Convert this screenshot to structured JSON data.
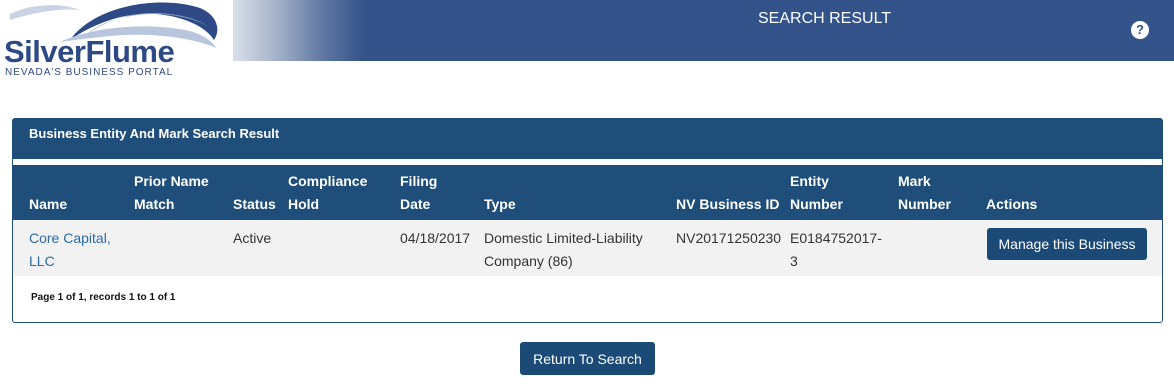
{
  "header": {
    "logo_main": "SilverFlume",
    "logo_sub": "NEVADA'S BUSINESS PORTAL",
    "title": "SEARCH RESULT",
    "help_glyph": "?"
  },
  "results": {
    "panel_title": "Business Entity And Mark Search Result",
    "columns": {
      "name": "Name",
      "prior_name_1": "Prior Name",
      "prior_name_2": "Match",
      "status": "Status",
      "compliance_1": "Compliance",
      "compliance_2": "Hold",
      "filing_1": "Filing",
      "filing_2": "Date",
      "type": "Type",
      "nv_id": "NV Business ID",
      "entity_1": "Entity",
      "entity_2": "Number",
      "mark_1": "Mark",
      "mark_2": "Number",
      "actions": "Actions"
    },
    "rows": [
      {
        "name_1": "Core Capital,",
        "name_2": "LLC",
        "prior_name_match": "",
        "status": "Active",
        "compliance_hold": "",
        "filing_date": "04/18/2017",
        "type_1": "Domestic Limited-Liability",
        "type_2": "Company (86)",
        "nv_business_id": "NV20171250230",
        "entity_1": "E0184752017-",
        "entity_2": "3",
        "mark_number": "",
        "action_label": "Manage this Business"
      }
    ],
    "pager": "Page 1 of 1, records 1 to 1 of 1"
  },
  "return_button": "Return To Search",
  "colors": {
    "header_blue": "#34538a",
    "table_blue": "#1e4e79",
    "button_blue": "#1a4a75",
    "link_blue": "#2d6aa0"
  },
  "icons": {
    "help": "question-circle-icon"
  }
}
